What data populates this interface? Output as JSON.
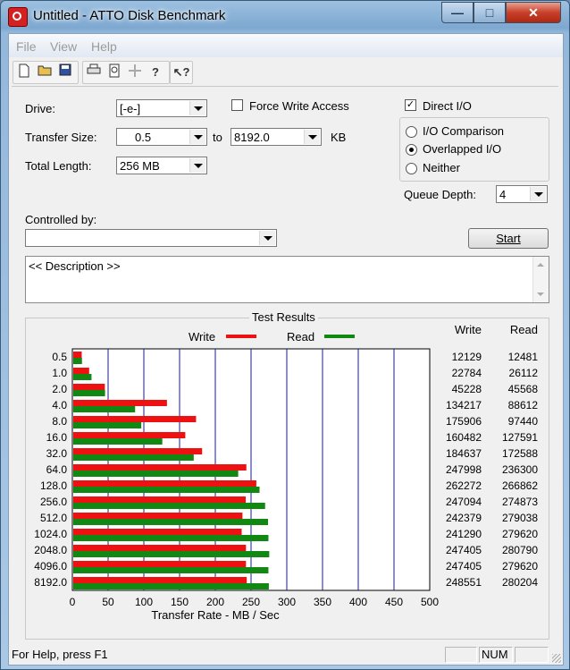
{
  "window": {
    "title": "Untitled - ATTO Disk Benchmark"
  },
  "menu": [
    "File",
    "View",
    "Help"
  ],
  "toolbar": [
    "new-document-icon",
    "open-folder-icon",
    "save-icon",
    "print-icon",
    "print-preview-icon",
    "move-icon",
    "help-icon",
    "context-help-icon"
  ],
  "form": {
    "drive_label": "Drive:",
    "drive_value": "[-e-]",
    "force_write_label": "Force Write Access",
    "force_write_checked": false,
    "direct_io_label": "Direct I/O",
    "direct_io_checked": true,
    "transfer_size_label": "Transfer Size:",
    "transfer_from": "0.5",
    "to_label": "to",
    "transfer_to": "8192.0",
    "kb_label": "KB",
    "total_length_label": "Total Length:",
    "total_length_value": "256 MB",
    "io_comparison_label": "I/O Comparison",
    "overlapped_io_label": "Overlapped I/O",
    "neither_label": "Neither",
    "selected_mode": "Overlapped I/O",
    "queue_depth_label": "Queue Depth:",
    "queue_depth_value": "4",
    "controlled_by_label": "Controlled by:",
    "controlled_by_value": "",
    "start_label": "Start",
    "description_text": "<< Description >>"
  },
  "results": {
    "title": "Test Results",
    "legend_write": "Write",
    "legend_read": "Read",
    "write_header": "Write",
    "read_header": "Read",
    "write_color": "#ee1111",
    "read_color": "#118811"
  },
  "chart_data": {
    "type": "bar",
    "title": "Test Results",
    "xlabel": "Transfer Rate - MB / Sec",
    "xlim": [
      0,
      500
    ],
    "xticks": [
      "0",
      "50",
      "100",
      "150",
      "200",
      "250",
      "300",
      "350",
      "400",
      "450",
      "500"
    ],
    "categories": [
      "0.5",
      "1.0",
      "2.0",
      "4.0",
      "8.0",
      "16.0",
      "32.0",
      "64.0",
      "128.0",
      "256.0",
      "512.0",
      "1024.0",
      "2048.0",
      "4096.0",
      "8192.0"
    ],
    "series": [
      {
        "name": "Write",
        "values": [
          12129,
          22784,
          45228,
          134217,
          175906,
          160482,
          184637,
          247998,
          262272,
          247094,
          242379,
          241290,
          247405,
          247405,
          248551
        ]
      },
      {
        "name": "Read",
        "values": [
          12481,
          26112,
          45568,
          88612,
          97440,
          127591,
          172588,
          236300,
          266862,
          274873,
          279038,
          279620,
          280790,
          279620,
          280204
        ]
      }
    ],
    "orientation": "horizontal",
    "grid": true,
    "legend": "top"
  },
  "statusbar": {
    "help_text": "For Help, press F1",
    "num": "NUM"
  }
}
